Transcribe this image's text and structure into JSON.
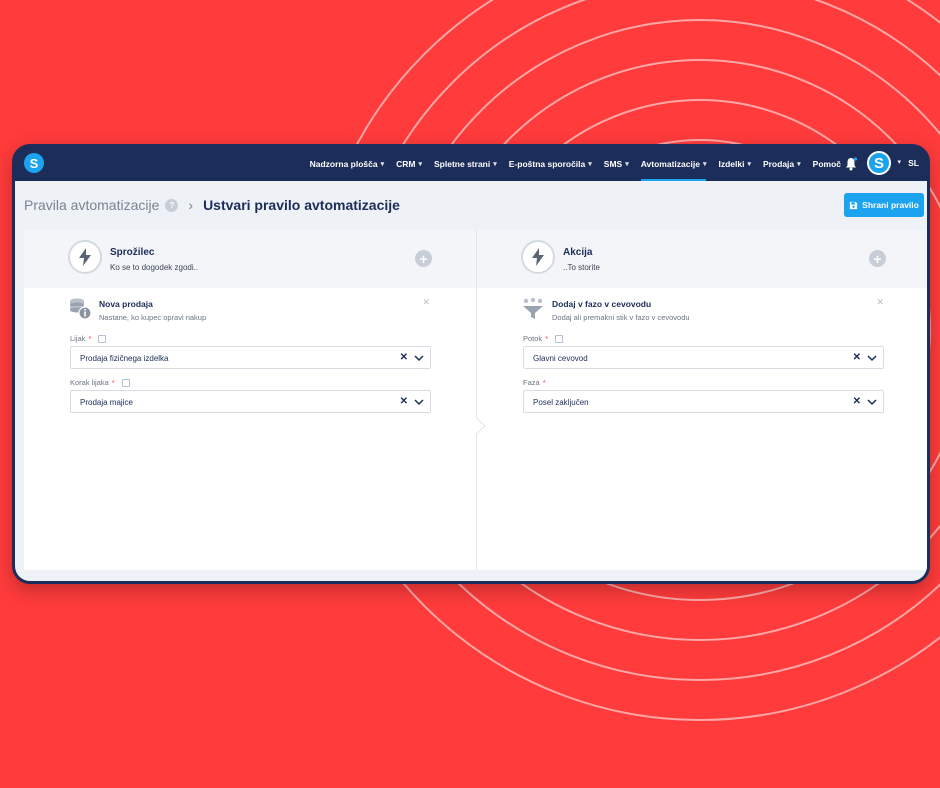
{
  "nav": {
    "items": [
      {
        "label": "Nadzorna plošča",
        "active": false
      },
      {
        "label": "CRM",
        "active": false
      },
      {
        "label": "Spletne strani",
        "active": false
      },
      {
        "label": "E-poštna sporočila",
        "active": false
      },
      {
        "label": "SMS",
        "active": false
      },
      {
        "label": "Avtomatizacije",
        "active": true
      },
      {
        "label": "Izdelki",
        "active": false
      },
      {
        "label": "Prodaja",
        "active": false
      },
      {
        "label": "Pomoč",
        "active": false
      }
    ],
    "logo_letter": "S",
    "avatar_letter": "S",
    "language": "SL"
  },
  "breadcrumb": {
    "parent": "Pravila avtomatizacije",
    "help_icon": "?",
    "current": "Ustvari pravilo avtomatizacije"
  },
  "save_button": {
    "label": "Shrani pravilo",
    "icon": "floppy-disk-icon"
  },
  "trigger": {
    "title": "Sprožilec",
    "subtitle": "Ko se to dogodek zgodi..",
    "block": {
      "title": "Nova prodaja",
      "description": "Nastane, ko kupec opravi nakup"
    },
    "fields": [
      {
        "label": "Lijak",
        "value": "Prodaja fizičnega izdelka",
        "has_link": true
      },
      {
        "label": "Korak lijaka",
        "value": "Prodaja majice",
        "has_link": true
      }
    ]
  },
  "action": {
    "title": "Akcija",
    "subtitle": "..To storite",
    "block": {
      "title": "Dodaj v fazo v cevovodu",
      "description": "Dodaj ali premakni stik v fazo v cevovodu"
    },
    "fields": [
      {
        "label": "Potok",
        "value": "Glavni cevovod",
        "has_link": true
      },
      {
        "label": "Faza",
        "value": "Posel zaključen",
        "has_link": false
      }
    ]
  },
  "colors": {
    "background": "#ff3b3b",
    "navbar": "#1c2d5a",
    "accent": "#1ba3f0"
  }
}
